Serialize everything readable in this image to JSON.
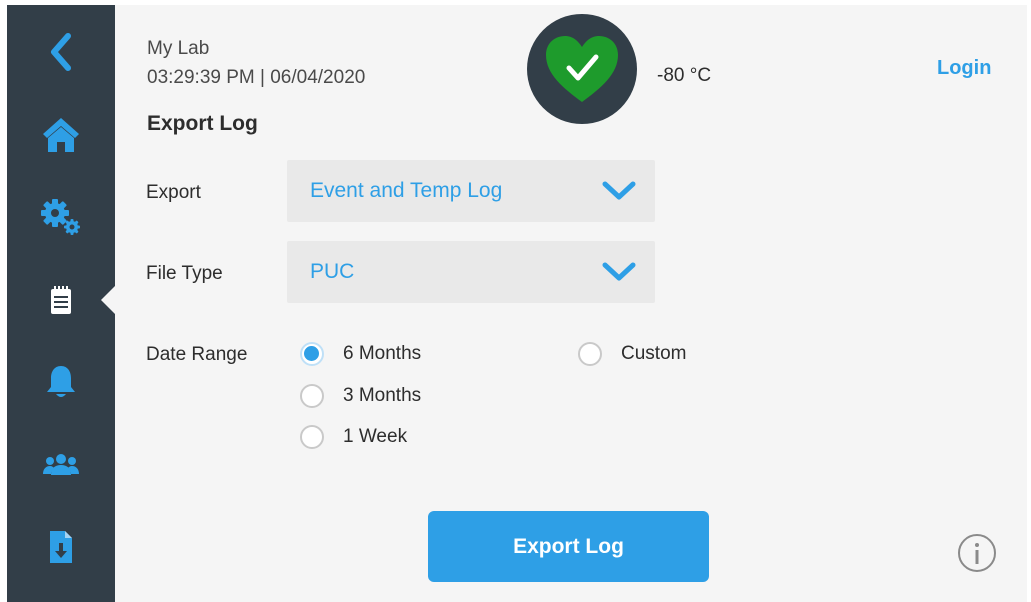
{
  "header": {
    "lab_name": "My Lab",
    "datetime": "03:29:39 PM | 06/04/2020",
    "title": "Export Log",
    "temperature": "-80 °C",
    "login_label": "Login"
  },
  "sidebar": {
    "items": [
      {
        "icon": "back-chevron-icon"
      },
      {
        "icon": "home-icon"
      },
      {
        "icon": "settings-gears-icon"
      },
      {
        "icon": "log-notepad-icon",
        "active": true
      },
      {
        "icon": "alarm-bell-icon"
      },
      {
        "icon": "users-icon"
      },
      {
        "icon": "file-download-icon"
      }
    ]
  },
  "form": {
    "export": {
      "label": "Export",
      "value": "Event and Temp Log"
    },
    "file_type": {
      "label": "File Type",
      "value": "PUC"
    },
    "date_range": {
      "label": "Date Range",
      "options": [
        {
          "label": "6 Months",
          "checked": true
        },
        {
          "label": "3 Months",
          "checked": false
        },
        {
          "label": "1 Week",
          "checked": false
        },
        {
          "label": "Custom",
          "checked": false
        }
      ]
    },
    "export_button": "Export Log"
  },
  "status": {
    "icon": "heart-check-icon",
    "state_color": "#1e9b2c"
  },
  "colors": {
    "accent": "#2e9fe6",
    "sidebar": "#323e48",
    "background": "#f5f5f5",
    "status_ok": "#1e9b2c"
  }
}
